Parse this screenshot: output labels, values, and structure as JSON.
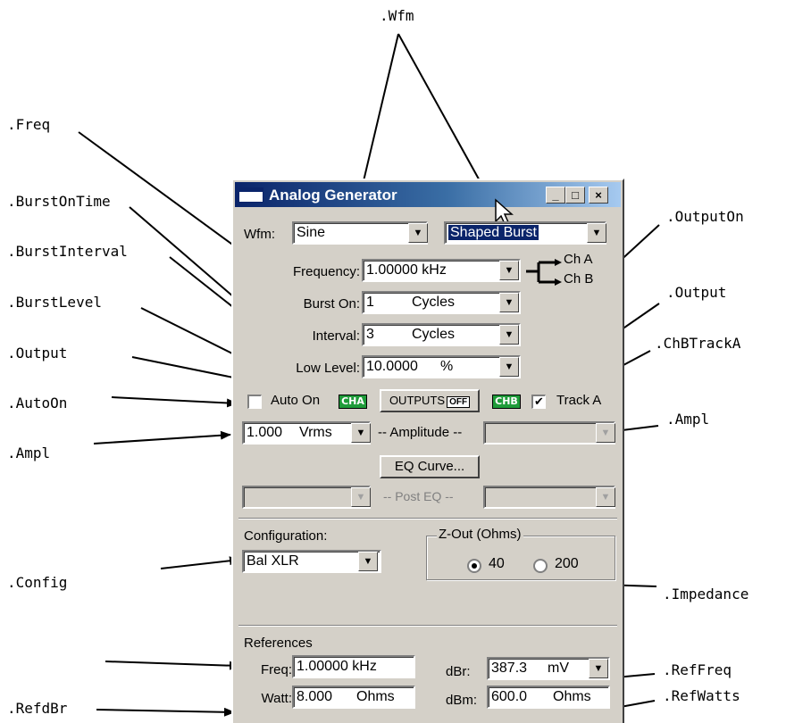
{
  "callouts": {
    "wfm": ".Wfm",
    "freq": ".Freq",
    "burst_on_time": ".BurstOnTime",
    "burst_interval": ".BurstInterval",
    "burst_level": ".BurstLevel",
    "output_left": ".Output",
    "auto_on": ".AutoOn",
    "ampl_left": ".Ampl",
    "config": ".Config",
    "refdbr": ".RefdBr",
    "output_on": ".OutputOn",
    "output_right": ".Output",
    "chb_track_a": ".ChBTrackA",
    "ampl_right": ".Ampl",
    "impedance": ".Impedance",
    "ref_freq": ".RefFreq",
    "ref_watts": ".RefWatts"
  },
  "window": {
    "title": "Analog Generator",
    "minimize": "_",
    "maximize": "□",
    "close": "×"
  },
  "wfm": {
    "label": "Wfm:",
    "value": "Sine",
    "type_value": "Shaped Burst"
  },
  "frequency": {
    "label": "Frequency:",
    "value": "1.00000 kHz"
  },
  "burst_on": {
    "label": "Burst On:",
    "value": "1",
    "unit": "Cycles"
  },
  "interval": {
    "label": "Interval:",
    "value": "3",
    "unit": "Cycles"
  },
  "low_level": {
    "label": "Low Level:",
    "value": "10.0000",
    "unit": "%"
  },
  "channels": {
    "a": "Ch A",
    "b": "Ch B"
  },
  "auto_on": {
    "label": "Auto On",
    "checked": false
  },
  "cha_led": "CHA",
  "outputs_button": {
    "label": "OUTPUTS",
    "state": "OFF"
  },
  "chb_led": "CHB",
  "track_a": {
    "label": "Track A",
    "checked": true
  },
  "amplitude": {
    "value": "1.000",
    "unit": "Vrms",
    "label": "-- Amplitude --"
  },
  "eq_curve_button": "EQ Curve...",
  "post_eq": "-- Post EQ --",
  "configuration": {
    "label": "Configuration:",
    "value": "Bal XLR"
  },
  "z_out": {
    "label": "Z-Out (Ohms)",
    "options": [
      "40",
      "200"
    ],
    "selected": "40"
  },
  "references": {
    "title": "References",
    "freq_label": "Freq:",
    "freq_value": "1.00000 kHz",
    "watts_label": "Watt:",
    "watts_value": "8.000",
    "watts_unit": "Ohms",
    "dbr_label": "dBr:",
    "dbr_value": "387.3",
    "dbr_unit": "mV",
    "dbm_label": "dBm:",
    "dbm_value": "600.0",
    "dbm_unit": "Ohms"
  }
}
